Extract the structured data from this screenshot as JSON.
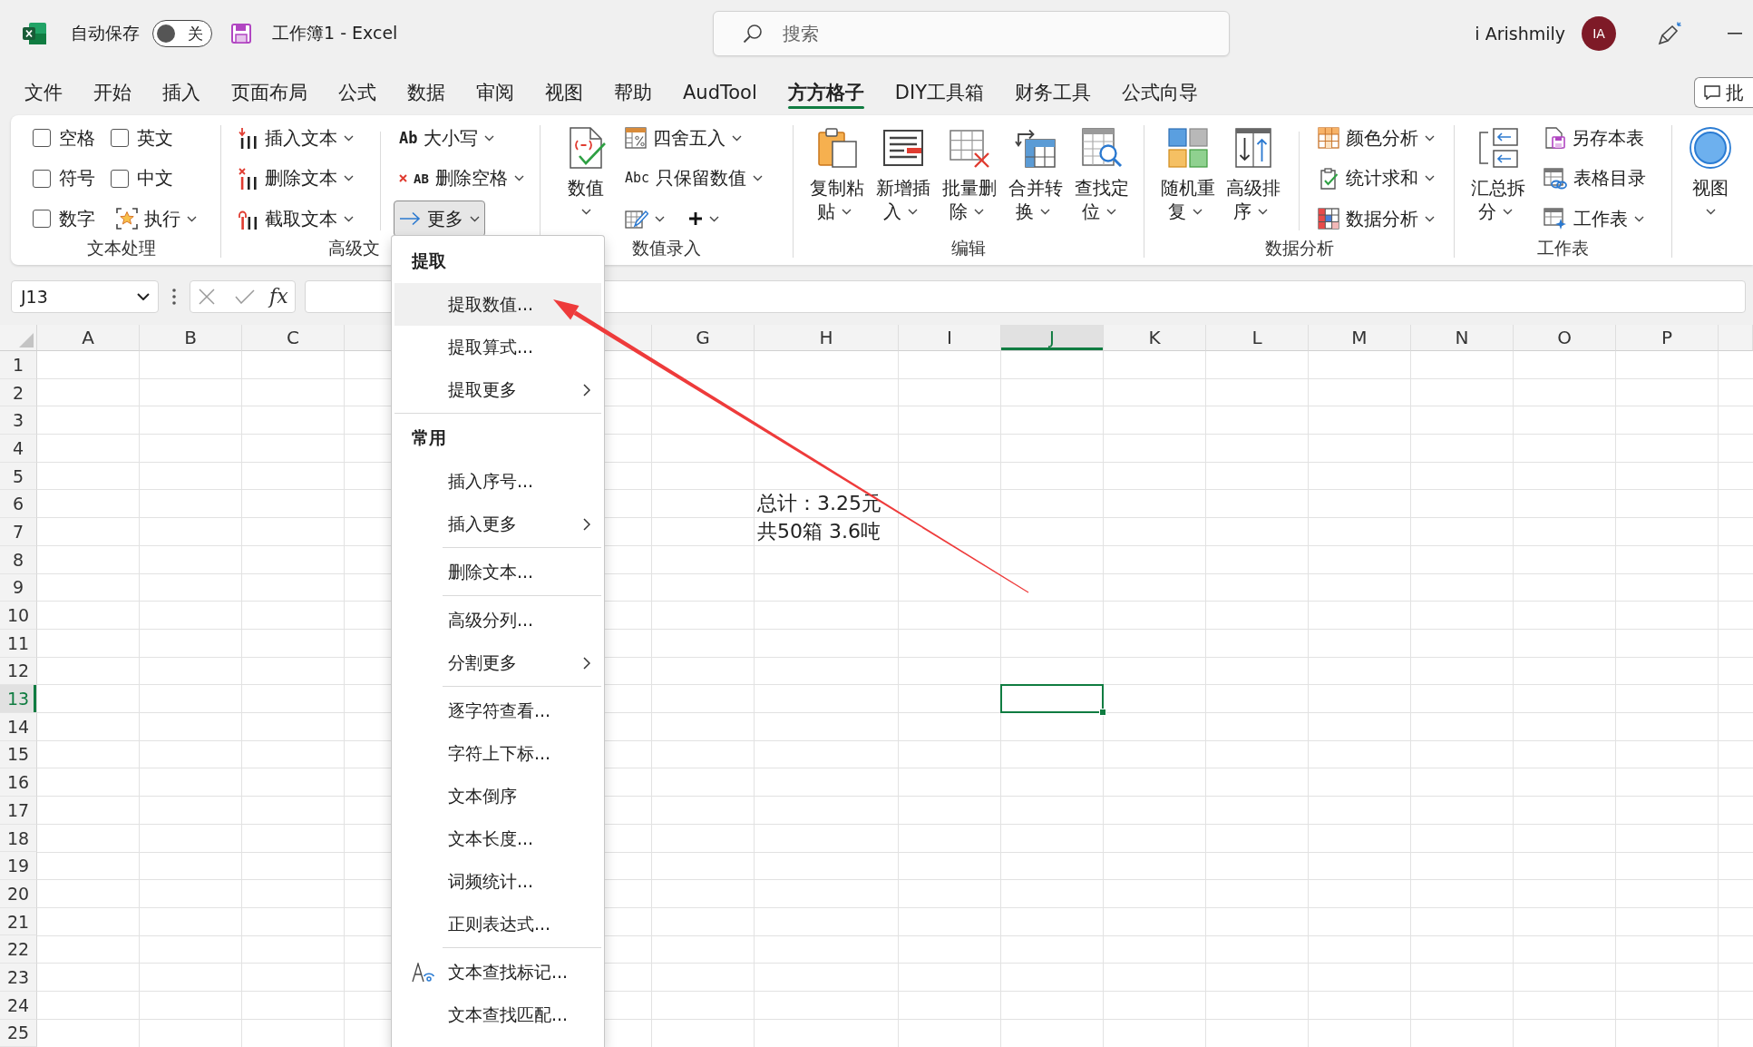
{
  "title_bar": {
    "autosave": {
      "label": "自动保存",
      "on": false,
      "state": "关"
    },
    "document_title": "工作簿1 - Excel",
    "search": {
      "placeholder": "搜索"
    },
    "account": {
      "name": "i Arishmily",
      "initials": "IA"
    }
  },
  "ribbon_tabs": [
    {
      "label": "文件",
      "selected": false
    },
    {
      "label": "开始",
      "selected": false
    },
    {
      "label": "插入",
      "selected": false
    },
    {
      "label": "页面布局",
      "selected": false
    },
    {
      "label": "公式",
      "selected": false
    },
    {
      "label": "数据",
      "selected": false
    },
    {
      "label": "审阅",
      "selected": false
    },
    {
      "label": "视图",
      "selected": false
    },
    {
      "label": "帮助",
      "selected": false
    },
    {
      "label": "AudTool",
      "selected": false
    },
    {
      "label": "方方格子",
      "selected": true
    },
    {
      "label": "DIY工具箱",
      "selected": false
    },
    {
      "label": "财务工具",
      "selected": false
    },
    {
      "label": "公式向导",
      "selected": false
    }
  ],
  "comments_button": {
    "label": "批"
  },
  "ribbon": {
    "groups": [
      {
        "label": "文本处理",
        "stacks": [
          {
            "kind": "column",
            "rows": [
              [
                {
                  "kind": "checkbox",
                  "label": "空格",
                  "checked": false
                }
              ],
              [
                {
                  "kind": "checkbox",
                  "label": "符号",
                  "checked": false
                }
              ],
              [
                {
                  "kind": "checkbox",
                  "label": "数字",
                  "checked": false
                }
              ]
            ]
          },
          {
            "kind": "column",
            "rows": [
              [
                {
                  "kind": "checkbox",
                  "label": "英文",
                  "checked": false
                }
              ],
              [
                {
                  "kind": "checkbox",
                  "label": "中文",
                  "checked": false
                }
              ],
              [
                {
                  "kind": "button",
                  "label": "执行",
                  "dropdown": true,
                  "expanded": false
                }
              ]
            ]
          }
        ]
      },
      {
        "label": "高级文",
        "stacks": [
          {
            "kind": "column",
            "rows": [
              [
                {
                  "kind": "button",
                  "label": "插入文本",
                  "dropdown": true,
                  "expanded": false
                }
              ],
              [
                {
                  "kind": "button",
                  "label": "删除文本",
                  "dropdown": true,
                  "expanded": false
                }
              ],
              [
                {
                  "kind": "button",
                  "label": "截取文本",
                  "dropdown": true,
                  "expanded": false
                }
              ]
            ]
          },
          {
            "kind": "divider"
          },
          {
            "kind": "column",
            "rows": [
              [
                {
                  "kind": "button",
                  "glyph": "Ab",
                  "label": "大小写",
                  "dropdown": true,
                  "expanded": false
                }
              ],
              [
                {
                  "kind": "button",
                  "glyph": "AB",
                  "label": "删除空格",
                  "dropdown": true,
                  "expanded": false
                }
              ],
              [
                {
                  "kind": "button",
                  "label": "更多",
                  "dropdown": true,
                  "expanded": true
                }
              ]
            ]
          }
        ]
      },
      {
        "label": "数值录入",
        "stacks": [
          {
            "kind": "large",
            "label": "数值",
            "dropdown": true,
            "expanded": false
          },
          {
            "kind": "column",
            "rows": [
              [
                {
                  "kind": "button",
                  "label": "四舍五入",
                  "dropdown": true,
                  "expanded": false
                }
              ],
              [
                {
                  "kind": "button",
                  "glyph": "Abc",
                  "label": "只保留数值",
                  "dropdown": true,
                  "expanded": false
                }
              ],
              [
                {
                  "kind": "icon-button",
                  "dropdown": true,
                  "expanded": false
                },
                {
                  "kind": "icon-button",
                  "dropdown": true,
                  "expanded": false
                }
              ]
            ]
          }
        ]
      },
      {
        "label": "编辑",
        "stacks": [
          {
            "kind": "large",
            "label": "复制粘贴",
            "dropdown": true,
            "expanded": false
          },
          {
            "kind": "large",
            "label": "新增插入",
            "dropdown": true,
            "expanded": false
          },
          {
            "kind": "large",
            "label": "批量删除",
            "dropdown": true,
            "expanded": false
          },
          {
            "kind": "large",
            "label": "合并转换",
            "dropdown": true,
            "expanded": false
          },
          {
            "kind": "large",
            "label": "查找定位",
            "dropdown": true,
            "expanded": false
          }
        ]
      },
      {
        "label": "数据分析",
        "stacks": [
          {
            "kind": "large",
            "label": "随机重复",
            "dropdown": true,
            "expanded": false
          },
          {
            "kind": "large",
            "label": "高级排序",
            "dropdown": true,
            "expanded": false
          },
          {
            "kind": "divider"
          },
          {
            "kind": "column",
            "rows": [
              [
                {
                  "kind": "button",
                  "label": "颜色分析",
                  "dropdown": true,
                  "expanded": false
                }
              ],
              [
                {
                  "kind": "button",
                  "label": "统计求和",
                  "dropdown": true,
                  "expanded": false
                }
              ],
              [
                {
                  "kind": "button",
                  "label": "数据分析",
                  "dropdown": true,
                  "expanded": false
                }
              ]
            ]
          }
        ]
      },
      {
        "label": "工作表",
        "stacks": [
          {
            "kind": "large",
            "label": "汇总拆分",
            "dropdown": true,
            "expanded": false
          },
          {
            "kind": "column",
            "rows": [
              [
                {
                  "kind": "button",
                  "label": "另存本表",
                  "dropdown": false,
                  "expanded": false
                }
              ],
              [
                {
                  "kind": "button",
                  "label": "表格目录",
                  "dropdown": false,
                  "expanded": false
                }
              ],
              [
                {
                  "kind": "button",
                  "label": "工作表",
                  "dropdown": true,
                  "expanded": false
                }
              ]
            ]
          }
        ]
      },
      {
        "stacks": [
          {
            "kind": "large",
            "label": "视图",
            "dropdown": true,
            "expanded": false
          }
        ]
      }
    ]
  },
  "formula_bar": {
    "name_box": "J13",
    "function_button": "fx"
  },
  "sheet": {
    "columns": [
      {
        "label": "A",
        "selected": false
      },
      {
        "label": "B",
        "selected": false
      },
      {
        "label": "C",
        "selected": false
      },
      {
        "selected": false
      },
      {},
      {
        "selected": false
      },
      {
        "label": "G",
        "selected": false
      },
      {
        "label": "H",
        "selected": false
      },
      {
        "label": "I",
        "selected": false
      },
      {
        "label": "J",
        "selected": true
      },
      {
        "label": "K",
        "selected": false
      },
      {
        "label": "L",
        "selected": false
      },
      {
        "label": "M",
        "selected": false
      },
      {
        "label": "N",
        "selected": false
      },
      {
        "label": "O",
        "selected": false
      },
      {
        "label": "P",
        "selected": false
      }
    ],
    "rows": [
      {
        "label": "1",
        "selected": false
      },
      {
        "label": "2",
        "selected": false
      },
      {
        "label": "3",
        "selected": false
      },
      {
        "label": "4",
        "selected": false
      },
      {
        "label": "5",
        "selected": false
      },
      {
        "label": "6",
        "selected": false,
        "cells": [
          null,
          null,
          null,
          null,
          null,
          null,
          null,
          "总计：3.25元"
        ]
      },
      {
        "label": "7",
        "selected": false,
        "cells": [
          null,
          null,
          null,
          null,
          null,
          null,
          null,
          "共50箱 3.6吨"
        ]
      },
      {
        "label": "8",
        "selected": false
      },
      {
        "label": "9",
        "selected": false
      },
      {
        "label": "10",
        "selected": false
      },
      {
        "label": "11",
        "selected": false
      },
      {
        "label": "12",
        "selected": false
      },
      {
        "label": "13",
        "selected": true
      },
      {
        "label": "14",
        "selected": false
      },
      {
        "label": "15",
        "selected": false
      },
      {
        "label": "16",
        "selected": false
      },
      {
        "label": "17",
        "selected": false
      },
      {
        "label": "18",
        "selected": false
      },
      {
        "label": "19",
        "selected": false
      },
      {
        "label": "20",
        "selected": false
      },
      {
        "label": "21",
        "selected": false
      },
      {
        "label": "22",
        "selected": false
      },
      {
        "label": "23",
        "selected": false
      },
      {
        "label": "24",
        "selected": false
      },
      {
        "label": "25",
        "selected": false
      }
    ]
  },
  "more_menu": {
    "sections": [
      {
        "header": "提取",
        "groups": [
          {
            "items": [
              {
                "label": "提取数值...",
                "highlighted": true,
                "submenu": false,
                "icon": false
              },
              {
                "label": "提取算式...",
                "highlighted": false,
                "submenu": false,
                "icon": false
              },
              {
                "label": "提取更多",
                "highlighted": false,
                "submenu": true,
                "icon": false
              }
            ]
          }
        ]
      },
      {
        "header": "常用",
        "groups": [
          {
            "items": [
              {
                "label": "插入序号...",
                "highlighted": false,
                "submenu": false,
                "icon": false
              },
              {
                "label": "插入更多",
                "highlighted": false,
                "submenu": true,
                "icon": false
              }
            ]
          },
          {
            "items": [
              {
                "label": "删除文本...",
                "highlighted": false,
                "submenu": false,
                "icon": false
              }
            ]
          },
          {
            "items": [
              {
                "label": "高级分列...",
                "highlighted": false,
                "submenu": false,
                "icon": false
              },
              {
                "label": "分割更多",
                "highlighted": false,
                "submenu": true,
                "icon": false
              }
            ]
          },
          {
            "items": [
              {
                "label": "逐字符查看...",
                "highlighted": false,
                "submenu": false,
                "icon": false
              },
              {
                "label": "字符上下标...",
                "highlighted": false,
                "submenu": false,
                "icon": false
              },
              {
                "label": "文本倒序",
                "highlighted": false,
                "submenu": false,
                "icon": false
              },
              {
                "label": "文本长度...",
                "highlighted": false,
                "submenu": false,
                "icon": false
              },
              {
                "label": "词频统计...",
                "highlighted": false,
                "submenu": false,
                "icon": false
              },
              {
                "label": "正则表达式...",
                "highlighted": false,
                "submenu": false,
                "icon": false
              }
            ]
          },
          {
            "items": [
              {
                "label": "文本查找标记...",
                "highlighted": false,
                "submenu": false,
                "icon": true
              },
              {
                "label": "文本查找匹配...",
                "highlighted": false,
                "submenu": false,
                "icon": false
              }
            ]
          }
        ]
      }
    ]
  }
}
